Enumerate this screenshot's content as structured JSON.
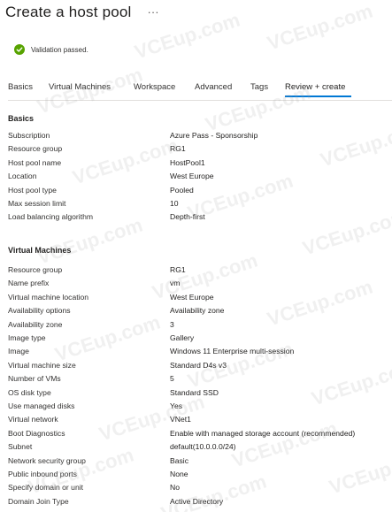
{
  "header": {
    "title": "Create a host pool",
    "more_label": "···"
  },
  "validation": {
    "status_color": "#57a300",
    "icon": "check-circle-icon",
    "text": "Validation passed."
  },
  "tabs": [
    {
      "label": "Basics",
      "active": false
    },
    {
      "label": "Virtual Machines",
      "active": false
    },
    {
      "label": "Workspace",
      "active": false
    },
    {
      "label": "Advanced",
      "active": false
    },
    {
      "label": "Tags",
      "active": false
    },
    {
      "label": "Review + create",
      "active": true
    }
  ],
  "accent_color": "#0078d4",
  "basics": {
    "title": "Basics",
    "rows": [
      {
        "label": "Subscription",
        "value": "Azure Pass - Sponsorship"
      },
      {
        "label": "Resource group",
        "value": "RG1"
      },
      {
        "label": "Host pool name",
        "value": "HostPool1"
      },
      {
        "label": "Location",
        "value": "West Europe"
      },
      {
        "label": "Host pool type",
        "value": "Pooled"
      },
      {
        "label": "Max session limit",
        "value": "10"
      },
      {
        "label": "Load balancing algorithm",
        "value": "Depth-first"
      }
    ]
  },
  "virtual_machines": {
    "title": "Virtual Machines",
    "rows": [
      {
        "label": "Resource group",
        "value": "RG1"
      },
      {
        "label": "Name prefix",
        "value": "vm"
      },
      {
        "label": "Virtual machine location",
        "value": "West Europe"
      },
      {
        "label": "Availability options",
        "value": "Availability zone"
      },
      {
        "label": "Availability zone",
        "value": "3"
      },
      {
        "label": "Image type",
        "value": "Gallery"
      },
      {
        "label": "Image",
        "value": "Windows 11 Enterprise multi-session"
      },
      {
        "label": "Virtual machine size",
        "value": "Standard D4s v3"
      },
      {
        "label": "Number of VMs",
        "value": "5"
      },
      {
        "label": "OS disk type",
        "value": "Standard SSD"
      },
      {
        "label": "Use managed disks",
        "value": "Yes"
      },
      {
        "label": "Virtual network",
        "value": "VNet1"
      },
      {
        "label": "Boot Diagnostics",
        "value": "Enable with managed storage account (recommended)"
      },
      {
        "label": "Subnet",
        "value": "default(10.0.0.0/24)"
      },
      {
        "label": "Network security group",
        "value": "Basic"
      },
      {
        "label": "Public inbound ports",
        "value": "None"
      },
      {
        "label": "Specify domain or unit",
        "value": "No"
      },
      {
        "label": "Domain Join Type",
        "value": "Active Directory"
      }
    ]
  },
  "watermark_text": "VCEup.com"
}
